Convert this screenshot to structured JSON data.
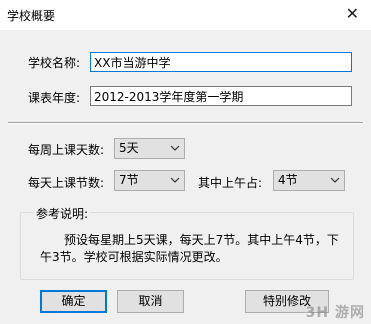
{
  "window": {
    "title": "学校概要",
    "close_glyph": "✕"
  },
  "fields": {
    "school_name_label": "学校名称:",
    "school_name_value": "XX市当游中学",
    "term_label": "课表年度:",
    "term_value": "2012-2013学年度第一学期"
  },
  "schedule": {
    "days_label": "每周上课天数:",
    "days_value": "5天",
    "periods_label": "每天上课节数:",
    "periods_value": "7节",
    "morning_label": "其中上午占:",
    "morning_value": "4节"
  },
  "reference": {
    "title": "参考说明:",
    "text": "预设每星期上5天课，每天上7节。其中上午4节，下午3节。学校可根据实际情况更改。"
  },
  "buttons": {
    "ok": "确定",
    "cancel": "取消",
    "special": "特别修改"
  },
  "watermark": "3H 游网"
}
